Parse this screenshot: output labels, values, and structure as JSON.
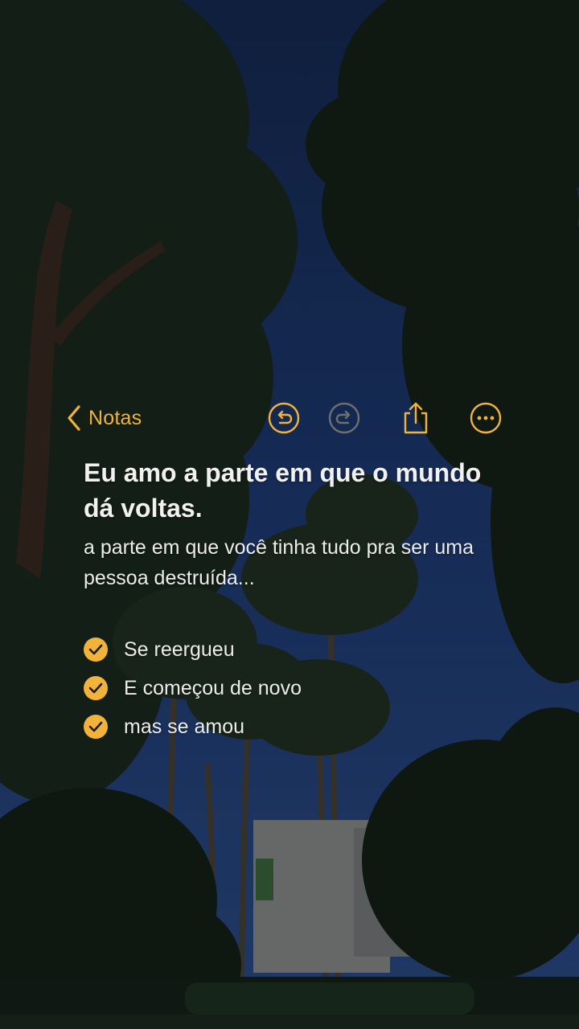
{
  "toolbar": {
    "back_label": "Notas",
    "icons": {
      "back": "chevron-left-icon",
      "undo": "undo-icon",
      "redo": "redo-icon",
      "share": "share-icon",
      "more": "more-icon"
    }
  },
  "note": {
    "title": "Eu amo a parte em que o mundo dá voltas.",
    "body": "a parte em que você tinha tudo pra ser uma pessoa destruída...",
    "checklist": [
      {
        "label": "Se reergueu",
        "checked": true
      },
      {
        "label": "E começou de novo",
        "checked": true
      },
      {
        "label": "mas se amou",
        "checked": true
      }
    ]
  },
  "colors": {
    "accent": "#f2b33a",
    "text": "#ececec",
    "sky": "#1d3a73"
  }
}
